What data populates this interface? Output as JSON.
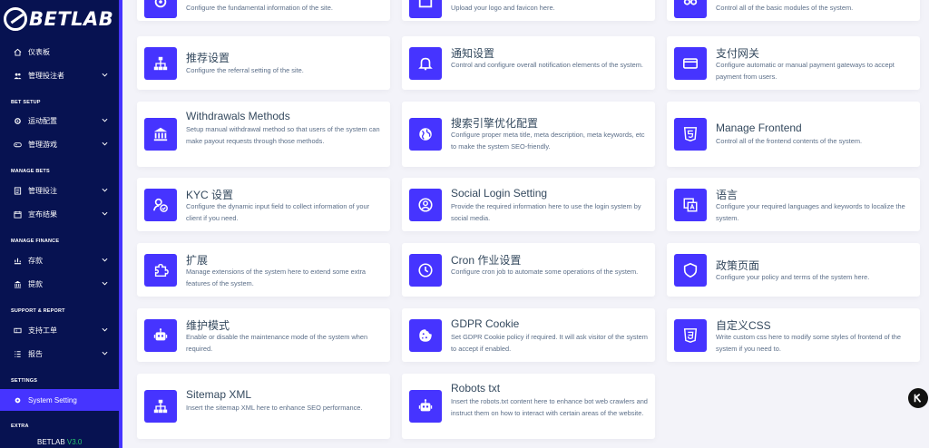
{
  "brand": {
    "name": "BETLAB"
  },
  "sidebar": {
    "items": [
      {
        "label": "仪表板",
        "icon": "home-icon",
        "has_chevron": false
      },
      {
        "label": "管理投注者",
        "icon": "users-icon",
        "has_chevron": true
      },
      {
        "label": "运动配置",
        "icon": "settings-icon",
        "has_chevron": true
      },
      {
        "label": "管理游戏",
        "icon": "gamepad-icon",
        "has_chevron": true
      },
      {
        "label": "管理投注",
        "icon": "list-icon",
        "has_chevron": true
      },
      {
        "label": "宣布结果",
        "icon": "calendar-icon",
        "has_chevron": true
      },
      {
        "label": "存款",
        "icon": "deposit-icon",
        "has_chevron": true
      },
      {
        "label": "提款",
        "icon": "bank-icon",
        "has_chevron": true
      },
      {
        "label": "支持工单",
        "icon": "ticket-icon",
        "has_chevron": true
      },
      {
        "label": "报告",
        "icon": "report-icon",
        "has_chevron": true
      },
      {
        "label": "System Setting",
        "icon": "gear-icon",
        "has_chevron": false,
        "active": true
      }
    ],
    "sections": {
      "bet_setup": "BET SETUP",
      "manage_bets": "MANAGE BETS",
      "manage_finance": "MANAGE FINANCE",
      "support_report": "SUPPORT & REPORT",
      "settings": "SETTINGS",
      "extra": "EXTRA"
    },
    "version_name": "BETLAB",
    "version_number": "V3.0"
  },
  "cards": [
    {
      "title": "",
      "desc": "Configure the fundamental information of the site.",
      "icon": "gear-icon"
    },
    {
      "title": "",
      "desc": "Upload your logo and favicon here.",
      "icon": "image-icon"
    },
    {
      "title": "",
      "desc": "Control all of the basic modules of the system.",
      "icon": "toggles-icon"
    },
    {
      "title": "推荐设置",
      "desc": "Configure the referral setting of the site.",
      "icon": "sitemap-icon"
    },
    {
      "title": "通知设置",
      "desc": "Control and configure overall notification elements of the system.",
      "icon": "bell-icon"
    },
    {
      "title": "支付网关",
      "desc": "Configure automatic or manual payment gateways to accept payment from users.",
      "icon": "credit-card-icon"
    },
    {
      "title": "Withdrawals Methods",
      "desc": "Setup manual withdrawal method so that users of the system can make payout requests through those methods.",
      "icon": "bank-icon"
    },
    {
      "title": "搜索引擎优化配置",
      "desc": "Configure proper meta title, meta description, meta keywords, etc to make the system SEO-friendly.",
      "icon": "globe-icon"
    },
    {
      "title": "Manage Frontend",
      "desc": "Control all of the frontend contents of the system.",
      "icon": "html5-icon"
    },
    {
      "title": "KYC 设置",
      "desc": "Configure the dynamic input field to collect information of your client if you need.",
      "icon": "user-check-icon"
    },
    {
      "title": "Social Login Setting",
      "desc": "Provide the required information here to use the login system by social media.",
      "icon": "user-circle-icon"
    },
    {
      "title": "语言",
      "desc": "Configure your required languages and keywords to localize the system.",
      "icon": "language-icon"
    },
    {
      "title": "扩展",
      "desc": "Manage extensions of the system here to extend some extra features of the system.",
      "icon": "puzzle-icon"
    },
    {
      "title": "Cron 作业设置",
      "desc": "Configure cron job to automate some operations of the system.",
      "icon": "clock-icon"
    },
    {
      "title": "政策页面",
      "desc": "Configure your policy and terms of the system here.",
      "icon": "shield-icon"
    },
    {
      "title": "维护模式",
      "desc": "Enable or disable the maintenance mode of the system when required.",
      "icon": "robot-icon"
    },
    {
      "title": "GDPR Cookie",
      "desc": "Set GDPR Cookie policy if required. It will ask visitor of the system to accept if enabled.",
      "icon": "cookie-icon"
    },
    {
      "title": "自定义CSS",
      "desc": "Write custom css here to modify some styles of frontend of the system if you need to.",
      "icon": "css3-icon"
    },
    {
      "title": "Sitemap XML",
      "desc": "Insert the sitemap XML here to enhance SEO performance.",
      "icon": "sitemap-icon"
    },
    {
      "title": "Robots txt",
      "desc": "Insert the robots.txt content here to enhance bot web crawlers and instruct them on how to interact with certain areas of the website.",
      "icon": "robot-icon"
    }
  ],
  "colors": {
    "sidebar": "#071251",
    "accent": "#4634ff",
    "background": "#f3f3f9",
    "version_green": "#28c76f"
  }
}
